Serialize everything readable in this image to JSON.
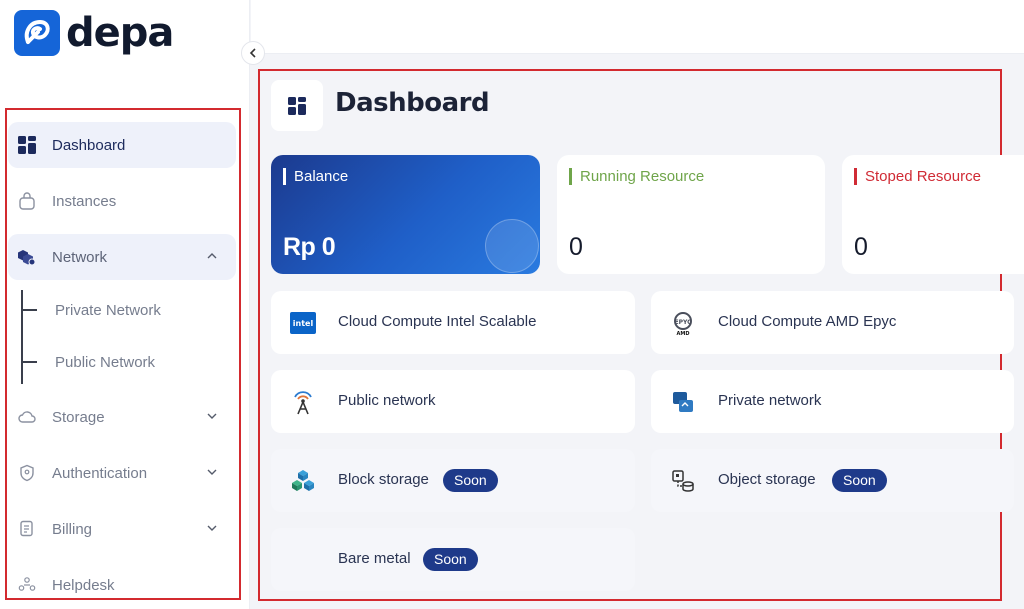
{
  "brand": {
    "name": "depa",
    "color": "#1565d8"
  },
  "sidebar": {
    "collapse_icon": "chevron-left-icon",
    "items": [
      {
        "label": "Dashboard",
        "icon": "grid-icon",
        "active": true
      },
      {
        "label": "Instances",
        "icon": "bag-icon"
      },
      {
        "label": "Network",
        "icon": "cubes-icon",
        "expanded": true,
        "children": [
          {
            "label": "Private Network"
          },
          {
            "label": "Public Network"
          }
        ]
      },
      {
        "label": "Storage",
        "icon": "cloud-icon"
      },
      {
        "label": "Authentication",
        "icon": "shield-icon"
      },
      {
        "label": "Billing",
        "icon": "receipt-icon"
      },
      {
        "label": "Helpdesk",
        "icon": "people-icon"
      }
    ]
  },
  "main": {
    "title": "Dashboard",
    "stats": {
      "balance": {
        "label": "Balance",
        "value": "Rp 0"
      },
      "running": {
        "label": "Running Resource",
        "value": "0",
        "color": "#6fa54a"
      },
      "stopped": {
        "label": "Stoped Resource",
        "value": "0",
        "color": "#d02b35"
      }
    },
    "services": [
      {
        "label": "Cloud Compute Intel Scalable",
        "icon": "intel-logo-icon"
      },
      {
        "label": "Cloud Compute AMD Epyc",
        "icon": "amd-epyc-icon"
      },
      {
        "label": "Public network",
        "icon": "antenna-icon"
      },
      {
        "label": "Private network",
        "icon": "private-network-icon"
      },
      {
        "label": "Block storage",
        "icon": "block-storage-icon",
        "badge": "Soon"
      },
      {
        "label": "Object storage",
        "icon": "object-storage-icon",
        "badge": "Soon"
      },
      {
        "label": "Bare metal",
        "icon": "bare-metal-icon",
        "badge": "Soon"
      }
    ]
  }
}
